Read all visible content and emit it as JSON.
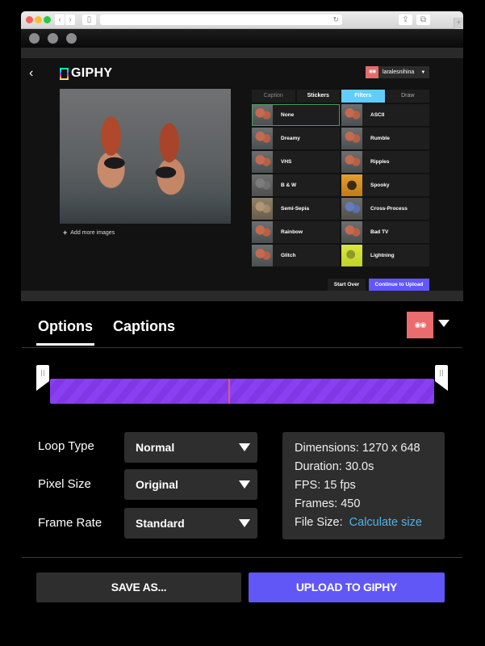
{
  "browser": {
    "back_icon": "‹",
    "forward_icon": "›",
    "sidebar_icon": "▯",
    "reload_icon": "↻",
    "share_icon": "⇪",
    "tabs_icon": "⧉",
    "newtab_icon": "+"
  },
  "webview": {
    "back_icon": "‹",
    "logo_text": "GIPHY",
    "user": {
      "avatar_eyes": "◉◉",
      "name": "laralesnihina",
      "caret": "▼"
    },
    "add_more_icon": "+",
    "add_more_label": "Add more images",
    "tool_tabs": [
      {
        "label": "Caption"
      },
      {
        "label": "Stickers"
      },
      {
        "label": "Filters"
      },
      {
        "label": "Draw"
      }
    ],
    "active_tool_tab": "Filters",
    "filters": [
      {
        "label": "None",
        "selected": true
      },
      {
        "label": "ASCII"
      },
      {
        "label": "Dreamy"
      },
      {
        "label": "Rumble"
      },
      {
        "label": "VHS"
      },
      {
        "label": "Ripples"
      },
      {
        "label": "B & W"
      },
      {
        "label": "Spooky"
      },
      {
        "label": "Semi-Sepia"
      },
      {
        "label": "Cross-Process"
      },
      {
        "label": "Rainbow"
      },
      {
        "label": "Bad TV"
      },
      {
        "label": "Glitch"
      },
      {
        "label": "Lightning"
      }
    ],
    "start_over_label": "Start Over",
    "continue_label": "Continue to Upload"
  },
  "panel": {
    "tabs": [
      {
        "label": "Options",
        "active": true
      },
      {
        "label": "Captions",
        "active": false
      }
    ],
    "avatar_eyes": "◉◉",
    "timeline": {
      "trim_start": 0,
      "trim_end": 1,
      "playhead": 0.465
    },
    "fields": [
      {
        "label": "Loop Type",
        "value": "Normal"
      },
      {
        "label": "Pixel Size",
        "value": "Original"
      },
      {
        "label": "Frame Rate",
        "value": "Standard"
      }
    ],
    "info": {
      "dimensions_label": "Dimensions:",
      "dimensions_value": "1270 x 648",
      "duration_label": "Duration:",
      "duration_value": "30.0s",
      "fps_label": "FPS:",
      "fps_value": "15 fps",
      "frames_label": "Frames:",
      "frames_value": "450",
      "filesize_label": "File Size:",
      "filesize_link": "Calculate size"
    },
    "save_label": "SAVE AS...",
    "upload_label": "UPLOAD TO GIPHY"
  },
  "colors": {
    "accent_purple": "#6157f6",
    "filters_tab_blue": "#61cdff",
    "timeline_purple": "#8b3ff2",
    "playhead_red": "#e25a6a",
    "avatar_red": "#ea6c6c",
    "link_blue": "#4fb3e8"
  }
}
